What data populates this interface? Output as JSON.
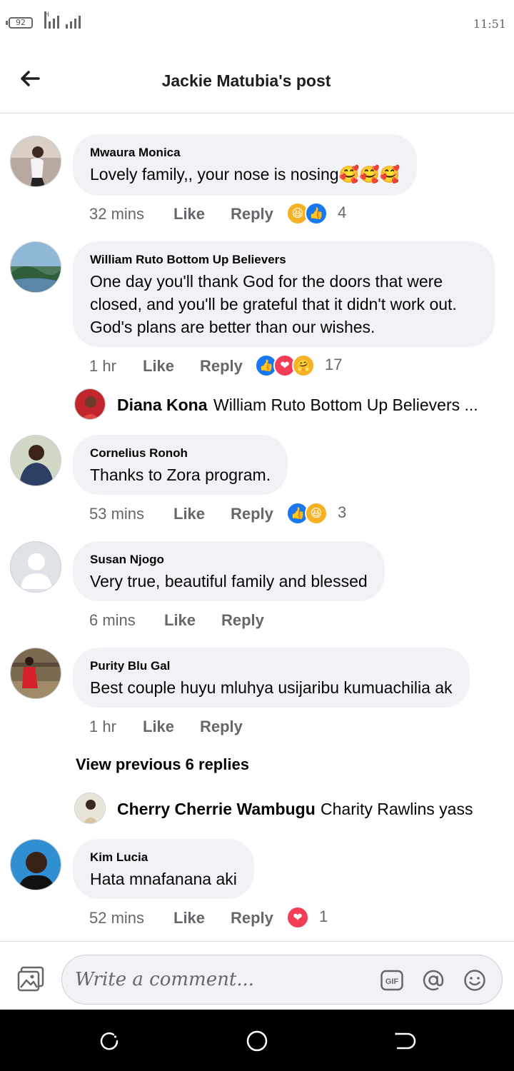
{
  "status_bar": {
    "battery": "92",
    "time": "11:51"
  },
  "header": {
    "title": "Jackie Matubia's post"
  },
  "comments": [
    {
      "author": "Mwaura Monica",
      "text": "Lovely family,, your nose is nosing🥰🥰🥰",
      "time": "32 mins",
      "like": "Like",
      "reply": "Reply",
      "reaction_count": "4"
    },
    {
      "author": "William Ruto Bottom Up Believers",
      "text_lines": [
        "One day you'll thank God for the doors that were",
        "closed, and you'll be grateful that it didn't work out.",
        "God's plans are better than our wishes."
      ],
      "time": "1 hr",
      "like": "Like",
      "reply": "Reply",
      "reaction_count": "17"
    },
    {
      "author": "Cornelius Ronoh",
      "text": "Thanks to Zora program.",
      "time": "53 mins",
      "like": "Like",
      "reply": "Reply",
      "reaction_count": "3"
    },
    {
      "author": "Susan Njogo",
      "text": "Very true, beautiful family and blessed",
      "time": "6 mins",
      "like": "Like",
      "reply": "Reply"
    },
    {
      "author": "Purity Blu Gal",
      "text": "Best couple huyu mluhya usijaribu kumuachilia ak",
      "time": "1 hr",
      "like": "Like",
      "reply": "Reply"
    },
    {
      "author": "Kim Lucia",
      "text": "Hata mnafanana aki",
      "time": "52 mins",
      "like": "Like",
      "reply": "Reply",
      "reaction_count": "1"
    }
  ],
  "replies": [
    {
      "author": "Diana Kona",
      "text": "William Ruto Bottom Up Believers ..."
    },
    {
      "author": "Cherry Cherrie Wambugu",
      "text": "Charity Rawlins yass"
    }
  ],
  "view_previous": "View previous 6 replies",
  "composer": {
    "placeholder": "Write a comment...",
    "gif": "GIF"
  },
  "icons": [
    "back-arrow-icon",
    "photo-icon",
    "gif-icon",
    "mention-icon",
    "emoji-icon",
    "like-reaction-icon",
    "love-reaction-icon",
    "haha-reaction-icon",
    "care-reaction-icon"
  ],
  "colors": {
    "like": "#1877f2",
    "love": "#f33e58",
    "haha": "#f7b125",
    "bubble": "#f0f2f5",
    "secondary_text": "#65676b"
  }
}
